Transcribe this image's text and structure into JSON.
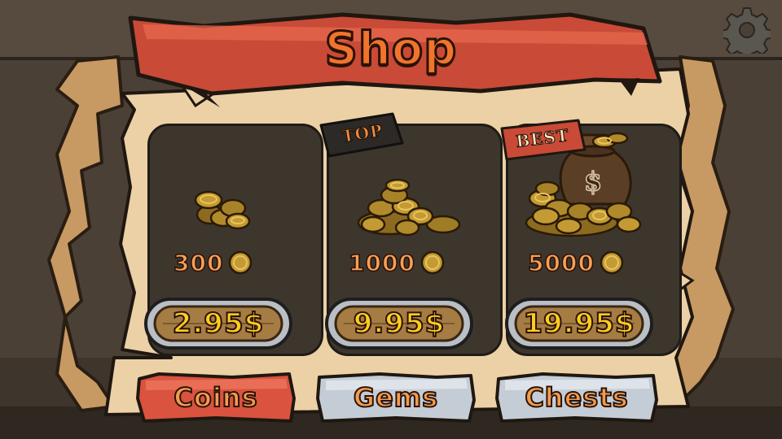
{
  "header": {
    "title": "Shop"
  },
  "settings": {
    "icon": "gear-icon"
  },
  "offers": [
    {
      "amount": "300",
      "price": "2.95$",
      "badge": "",
      "icon": "small-coin-pile-icon"
    },
    {
      "amount": "1000",
      "price": "9.95$",
      "badge": "TOP",
      "icon": "medium-coin-pile-icon"
    },
    {
      "amount": "5000",
      "price": "19.95$",
      "badge": "BEST",
      "icon": "money-bag-coin-pile-icon"
    }
  ],
  "tabs": [
    {
      "label": "Coins",
      "state": "selected"
    },
    {
      "label": "Gems",
      "state": "unselected"
    },
    {
      "label": "Chests",
      "state": "unselected"
    }
  ],
  "colors": {
    "selected_tab": "#d9533f",
    "unselected_tab": "#c4cdd6",
    "price_text": "#ffcc1f",
    "amount_text": "#f7a055",
    "title_text": "#f0742c"
  }
}
